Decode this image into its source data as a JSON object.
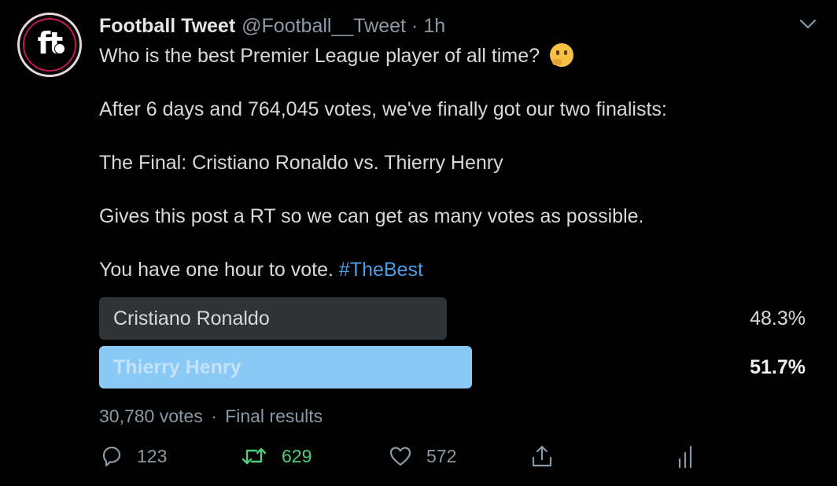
{
  "author": {
    "avatar_text": "ft",
    "display_name": "Football Tweet",
    "handle": "@Football__Tweet",
    "separator": "·",
    "time": "1h"
  },
  "tweet": {
    "line1": "Who is the best Premier League player of all time?",
    "line1_emoji": "thinking-face-emoji",
    "line2": "After 6 days and 764,045 votes, we've finally got our two finalists:",
    "line3": "The Final: Cristiano Ronaldo vs. Thierry Henry",
    "line4": "Gives this post a RT so we can get as many votes as possible.",
    "line5": "You have one hour to vote.",
    "hashtag": "#TheBest"
  },
  "poll": {
    "options": [
      {
        "label": "Cristiano Ronaldo",
        "percent_text": "48.3%",
        "percent": 48.3,
        "winner": false
      },
      {
        "label": "Thierry Henry",
        "percent_text": "51.7%",
        "percent": 51.7,
        "winner": true
      }
    ],
    "votes": "30,780 votes",
    "separator": "·",
    "status": "Final results"
  },
  "actions": {
    "reply_count": "123",
    "retweet_count": "629",
    "like_count": "572"
  },
  "colors": {
    "background": "#000000",
    "accent_link": "#4a9de4",
    "retweet_green": "#4fcf7a",
    "winner_bar": "#8ac8f5",
    "loser_bar": "#2f3336",
    "muted_text": "#8b98a5"
  },
  "icons": [
    "chevron-down-icon",
    "reply-icon",
    "retweet-icon",
    "like-icon",
    "share-icon",
    "analytics-icon"
  ]
}
